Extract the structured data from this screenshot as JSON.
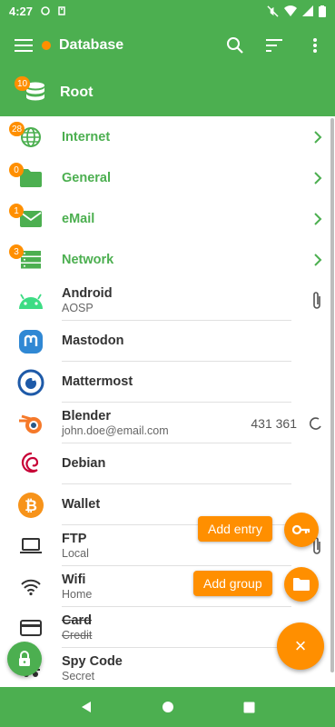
{
  "status": {
    "time": "4:27"
  },
  "toolbar": {
    "title": "Database",
    "icons": [
      "menu-icon",
      "search-icon",
      "sort-icon",
      "more-vert-icon"
    ]
  },
  "root": {
    "title": "Root",
    "badge": "10"
  },
  "groups": [
    {
      "name": "Internet",
      "badge": "28",
      "icon": "globe-icon"
    },
    {
      "name": "General",
      "badge": "0",
      "icon": "folder-icon"
    },
    {
      "name": "eMail",
      "badge": "1",
      "icon": "mail-icon"
    },
    {
      "name": "Network",
      "badge": "3",
      "icon": "server-icon"
    }
  ],
  "entries": [
    {
      "title": "Android",
      "sub": "AOSP",
      "icon": "android-icon",
      "attachment": true
    },
    {
      "title": "Mastodon",
      "sub": "",
      "icon": "mastodon-icon"
    },
    {
      "title": "Mattermost",
      "sub": "",
      "icon": "mattermost-icon"
    },
    {
      "title": "Blender",
      "sub": "john.doe@email.com",
      "icon": "blender-icon",
      "otp": "431 361"
    },
    {
      "title": "Debian",
      "sub": "",
      "icon": "debian-icon"
    },
    {
      "title": "Wallet",
      "sub": "",
      "icon": "bitcoin-icon"
    },
    {
      "title": "FTP",
      "sub": "Local",
      "icon": "laptop-icon",
      "attachment": true
    },
    {
      "title": "Wifi",
      "sub": "Home",
      "icon": "wifi-icon"
    },
    {
      "title": "Card",
      "sub": "Credit",
      "icon": "credit-card-icon",
      "expired": true
    },
    {
      "title": "Spy Code",
      "sub": "Secret",
      "icon": "secret-icon"
    }
  ],
  "fab": {
    "add_entry": "Add entry",
    "add_group": "Add group",
    "close": "×"
  },
  "colors": {
    "primary": "#4caf50",
    "accent": "#ff8f00"
  }
}
